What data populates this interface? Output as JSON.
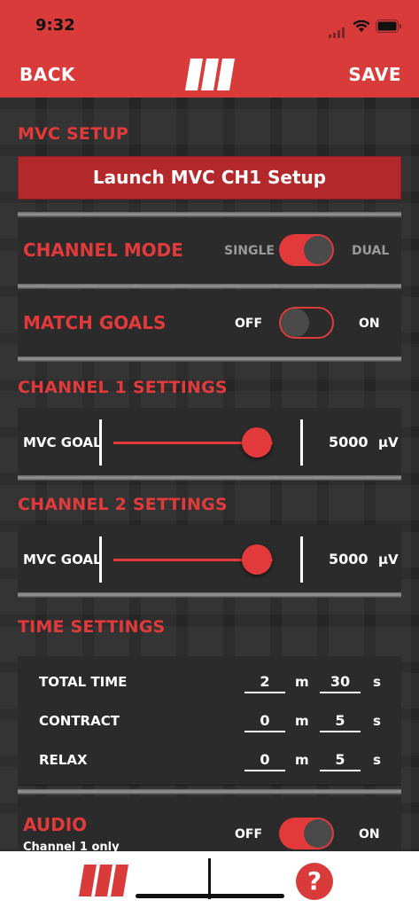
{
  "status": {
    "time": "9:32"
  },
  "nav": {
    "back": "BACK",
    "save": "SAVE",
    "logo": "m-logo-icon"
  },
  "mvc_setup": {
    "heading": "MVC SETUP",
    "launch": "Launch MVC CH1 Setup"
  },
  "channel_mode": {
    "label": "CHANNEL MODE",
    "left": "SINGLE",
    "right": "DUAL",
    "state": "on"
  },
  "match_goals": {
    "label": "MATCH GOALS",
    "left": "OFF",
    "right": "ON",
    "state": "off"
  },
  "ch1": {
    "heading": "CHANNEL 1 SETTINGS",
    "label": "MVC GOAL",
    "value": "5000",
    "unit": "µV",
    "fraction": 0.9
  },
  "ch2": {
    "heading": "CHANNEL 2 SETTINGS",
    "label": "MVC GOAL",
    "value": "5000",
    "unit": "µV",
    "fraction": 0.9
  },
  "time_settings": {
    "heading": "TIME SETTINGS",
    "rows": [
      {
        "label": "TOTAL TIME",
        "min": "2",
        "sec": "30",
        "m": "m",
        "s": "s"
      },
      {
        "label": "CONTRACT",
        "min": "0",
        "sec": "5",
        "m": "m",
        "s": "s"
      },
      {
        "label": "RELAX",
        "min": "0",
        "sec": "5",
        "m": "m",
        "s": "s"
      }
    ]
  },
  "audio": {
    "label": "AUDIO",
    "sub": "Channel 1 only",
    "left": "OFF",
    "right": "ON",
    "state": "on"
  },
  "tabbar": {
    "help": "?"
  },
  "colors": {
    "accent": "#d93b3a",
    "dark": "#262626"
  }
}
